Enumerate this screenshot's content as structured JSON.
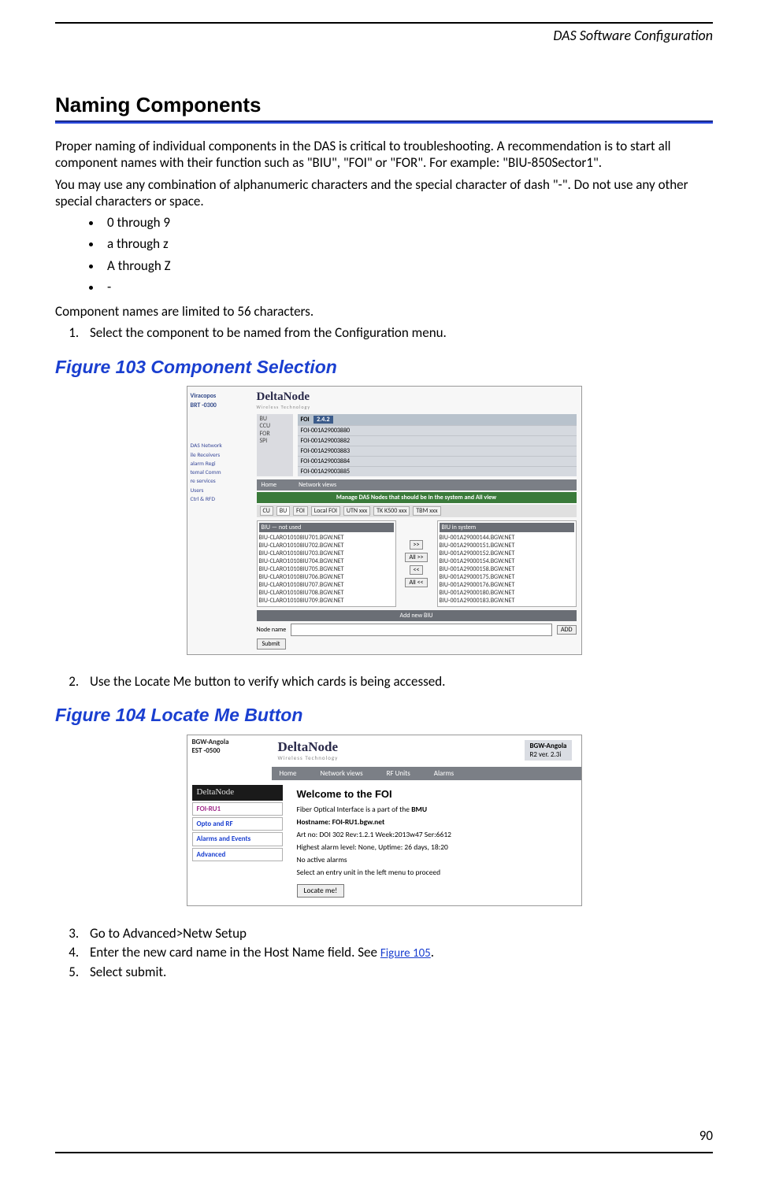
{
  "header": {
    "doc_section": "DAS Software Configuration"
  },
  "section_title": "Naming Components",
  "intro_p1": "Proper naming of individual components in the DAS is critical to troubleshooting.  A recommendation is to start all component names with their function such as \"BIU\", \"FOI\" or \"FOR\".  For example: \"BIU-850Sector1\".",
  "intro_p2": "You may use any combination of alphanumeric characters and the special character of dash \"-\".  Do not use any other special characters or space.",
  "bullets": [
    "0 through 9",
    "a through z",
    "A through Z",
    "-"
  ],
  "limit_line": "Component names are limited to 56 characters.",
  "steps_a": [
    "Select the component to be named from the Configuration menu."
  ],
  "fig103": {
    "caption": "Figure 103    Component Selection",
    "side_loc": "Viracopos",
    "side_tz": "BRT -0300",
    "brand": "DeltaNode",
    "brand_sub": "Wireless Technology",
    "col1": [
      "BU",
      "CCU",
      "FOR",
      "SPI"
    ],
    "foi_head": "FOI",
    "foi_big": "2.4.2",
    "foi_rows": [
      "FOI-001A29003880",
      "FOI-001A29003882",
      "FOI-001A29003883",
      "FOI-001A29003884",
      "FOI-001A29003885"
    ],
    "menu": [
      "Home",
      "Network views"
    ],
    "greenbar": "Manage DAS Nodes that should be in the system and All view",
    "tabs": [
      "CU",
      "BU",
      "FOI",
      "Local FOI",
      "UTN xxx",
      "TK K500 xxx",
      "TBM xxx"
    ],
    "list_left_h": "BIU — not used",
    "list_left": [
      "BIU-CLARO10108IU701.BGW.NET",
      "BIU-CLARO10108IU702.BGW.NET",
      "BIU-CLARO10108IU703.BGW.NET",
      "BIU-CLARO10108IU704.BGW.NET",
      "BIU-CLARO10108IU705.BGW.NET",
      "BIU-CLARO10108IU706.BGW.NET",
      "BIU-CLARO10108IU707.BGW.NET",
      "BIU-CLARO10108IU708.BGW.NET",
      "BIU-CLARO10108IU709.BGW.NET"
    ],
    "list_right_h": "BIU in system",
    "list_right": [
      "BIU-001A29000144.BGW.NET",
      "BIU-001A29000151.BGW.NET",
      "BIU-001A29000152.BGW.NET",
      "BIU-001A29000154.BGW.NET",
      "BIU-001A29000158.BGW.NET",
      "BIU-001A29000175.BGW.NET",
      "BIU-001A29000176.BGW.NET",
      "BIU-001A29000180.BGW.NET",
      "BIU-001A29000183.BGW.NET"
    ],
    "btn_right": ">>",
    "btn_allr": "All >>",
    "btn_left": "<<",
    "btn_alll": "All <<",
    "addrow": "Add new BIU",
    "node_lbl": "Node name",
    "add_btn": "ADD",
    "submit": "Submit",
    "sidenav": [
      "DAS Network",
      "ile Receivers",
      "alarm Regi",
      "temal Comm",
      "re services",
      "Users",
      "Ctrl & RFD"
    ]
  },
  "step2": "Use the Locate Me button to verify which cards is being accessed.",
  "fig104": {
    "caption": "Figure 104    Locate Me Button",
    "tz1": "BGW-Angola",
    "tz2": "EST -0500",
    "brand": "DeltaNode",
    "brand_sub": "Wireless   Technology",
    "hostlbl1": "BGW-Angola",
    "hostlbl2": "R2 ver. 2.3i",
    "menu": [
      "Home",
      "Network views",
      "RF Units",
      "Alarms"
    ],
    "brand2": "DeltaNode",
    "nav": [
      "FOI-RU1",
      "Opto and RF",
      "Alarms and Events",
      "Advanced"
    ],
    "h3": "Welcome to the FOI",
    "l1a": "Fiber Optical Interface is a part of the ",
    "l1b": "BMU",
    "l2a": "Hostname: ",
    "l2b": "FOI-RU1.bgw.net",
    "l3": "Art no: DOI 302 Rev:1.2.1 Week:2013w47 Ser:6612",
    "l4": "Highest alarm level: None,  Uptime: 26 days, 18:20",
    "l5": "No active alarms",
    "l6": "Select an entry unit in the left menu to proceed",
    "locate": "Locate me!"
  },
  "steps_b": {
    "s3": "Go to Advanced>Netw Setup",
    "s4a": "Enter the new card name in the Host Name field. See ",
    "s4link": "Figure 105",
    "s4b": ".",
    "s5": "Select submit."
  },
  "page_number": "90"
}
